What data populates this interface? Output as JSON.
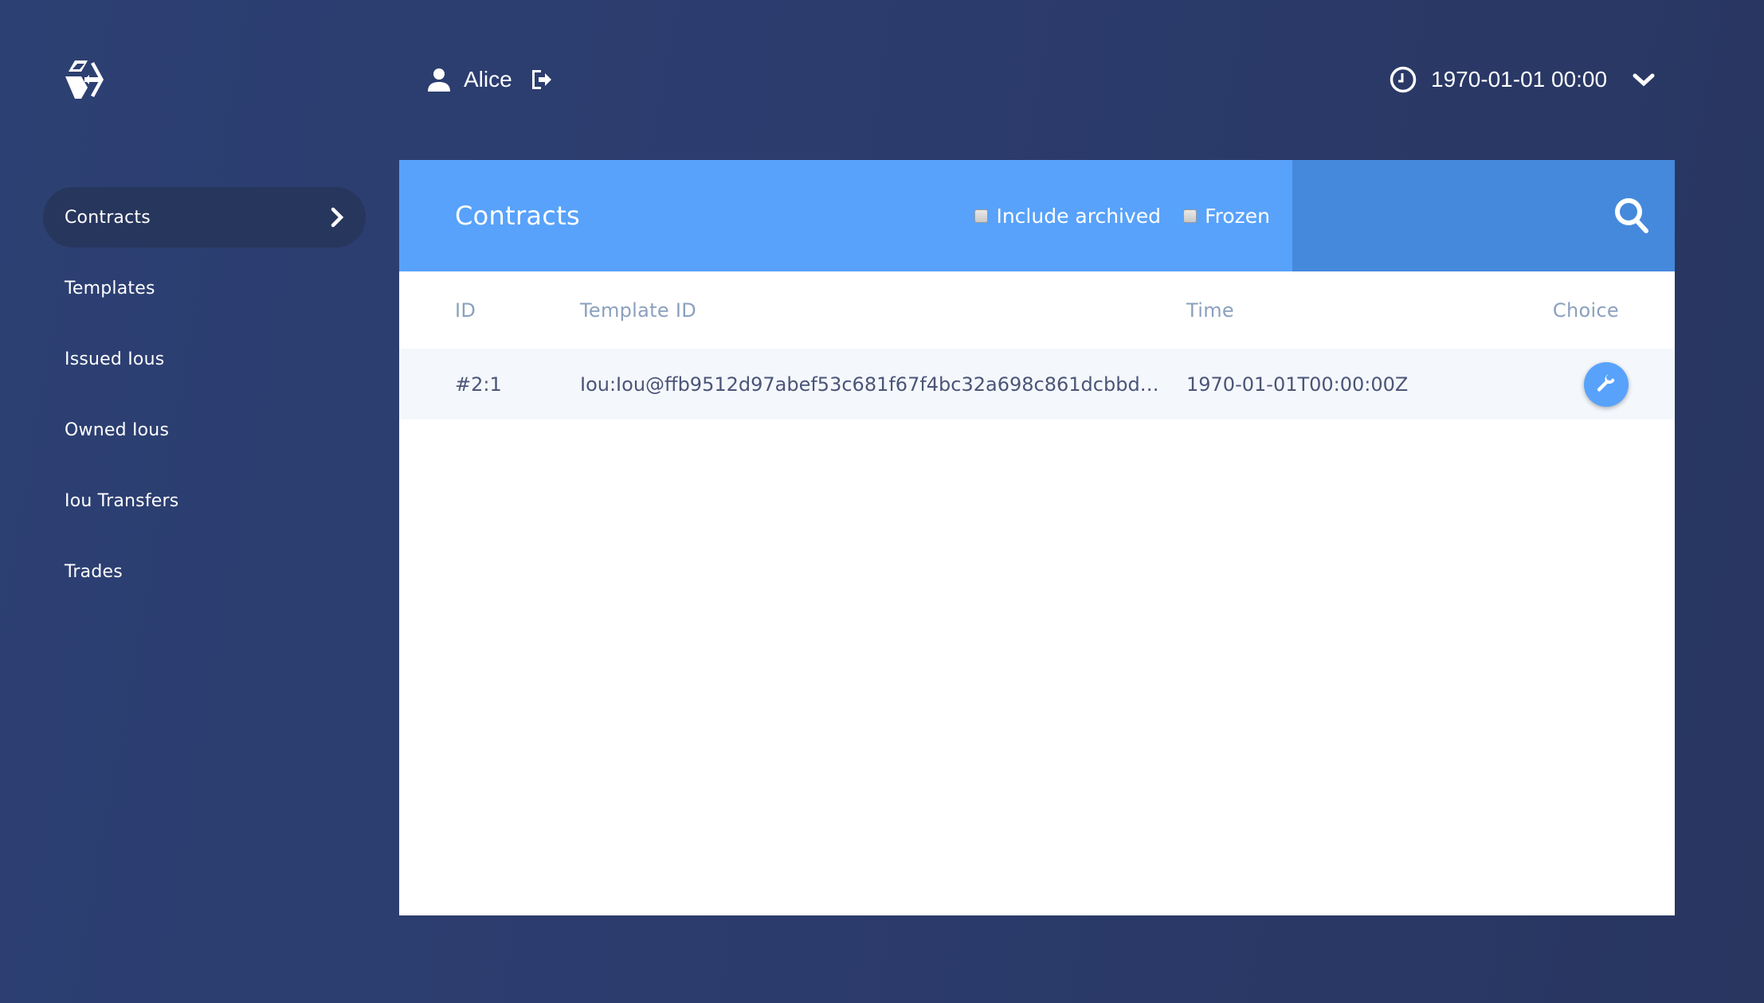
{
  "topbar": {
    "logo_icon": "app-logo-icon",
    "user_icon": "user-icon",
    "username": "Alice",
    "logout_icon": "logout-icon",
    "clock_icon": "clock-icon",
    "time": "1970-01-01 00:00",
    "time_dropdown_icon": "chevron-down-icon"
  },
  "sidebar": {
    "items": [
      {
        "label": "Contracts",
        "active": true,
        "icon": "chevron-right-icon"
      },
      {
        "label": "Templates",
        "active": false
      },
      {
        "label": "Issued Ious",
        "active": false
      },
      {
        "label": "Owned Ious",
        "active": false
      },
      {
        "label": "Iou Transfers",
        "active": false
      },
      {
        "label": "Trades",
        "active": false
      }
    ]
  },
  "panel": {
    "title": "Contracts",
    "filters": {
      "include_archived": {
        "label": "Include archived",
        "checked": false
      },
      "frozen": {
        "label": "Frozen",
        "checked": false
      }
    },
    "search_icon": "search-icon",
    "table": {
      "columns": [
        "ID",
        "Template ID",
        "Time",
        "Choice"
      ],
      "rows": [
        {
          "id": "#2:1",
          "template_id": "Iou:Iou@ffb9512d97abef53c681f67f4bc32a698c861dcbbd…",
          "time": "1970-01-01T00:00:00Z",
          "choice_icon": "wrench-icon"
        }
      ]
    }
  },
  "colors": {
    "background": "#2b3b6c",
    "accent": "#58a2fb",
    "search_area": "#4589dc",
    "active_nav": "#27365d",
    "row_bg": "#f4f7fc",
    "header_text": "#8ba0bd",
    "cell_text": "#4b5577"
  }
}
